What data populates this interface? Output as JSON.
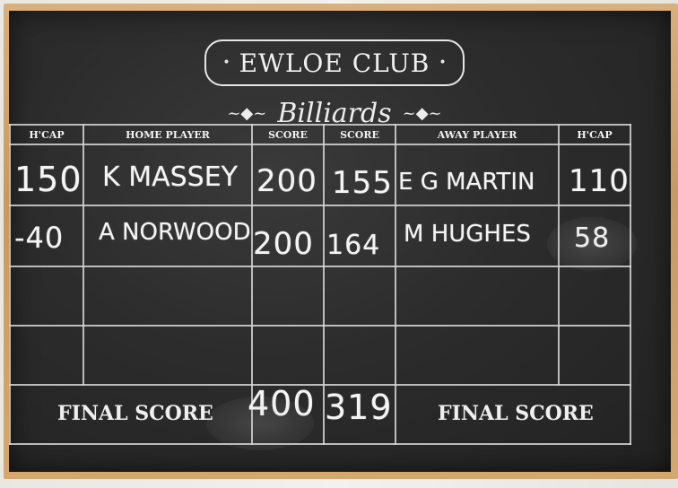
{
  "board": {
    "club_name": "EWLOE CLUB",
    "sport": "Billiards"
  },
  "table": {
    "headers": {
      "home_hcap": "H'CAP",
      "home_player": "HOME PLAYER",
      "home_score": "SCORE",
      "away_score": "SCORE",
      "away_player": "AWAY PLAYER",
      "away_hcap": "H'CAP"
    },
    "rows": [
      {
        "home_hcap": "150",
        "home_player": "K MASSEY",
        "home_score": "200",
        "away_score": "155",
        "away_player": "E G MARTIN",
        "away_hcap": "110"
      },
      {
        "home_hcap": "-40",
        "home_player": "A NORWOOD",
        "home_score": "200",
        "away_score": "164",
        "away_player": "M HUGHES",
        "away_hcap": "58"
      }
    ],
    "final": {
      "home_label": "FINAL SCORE",
      "home_total": "400",
      "away_total": "319",
      "away_label": "FINAL SCORE"
    }
  }
}
